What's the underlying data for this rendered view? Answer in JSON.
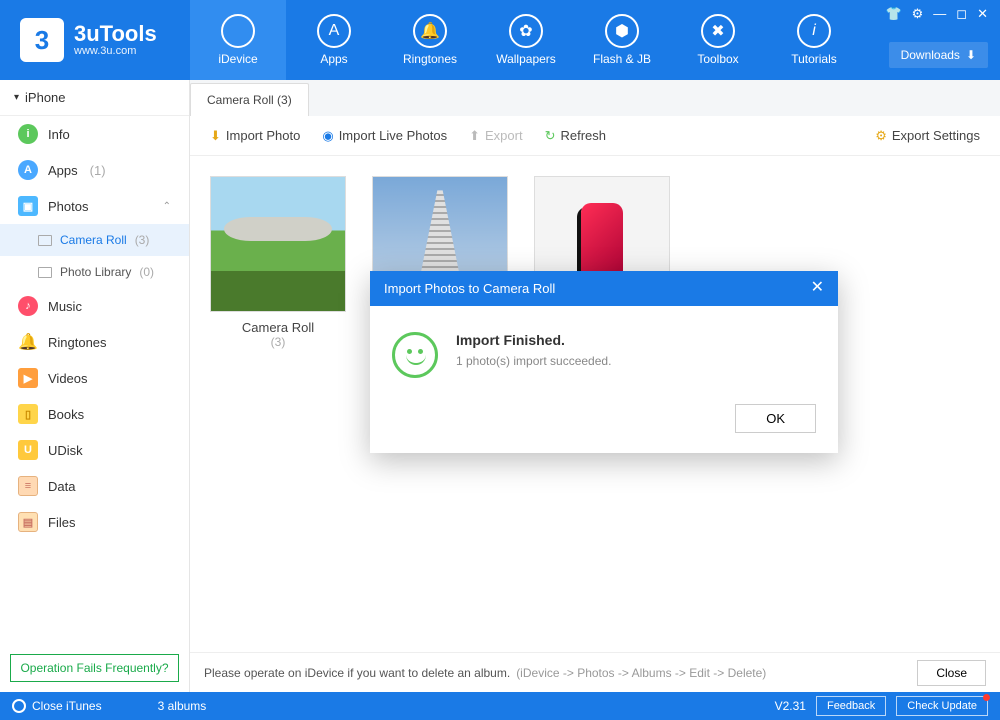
{
  "app": {
    "name": "3uTools",
    "url": "www.3u.com"
  },
  "nav": {
    "items": [
      {
        "label": "iDevice",
        "icon": "apple"
      },
      {
        "label": "Apps",
        "icon": "apps"
      },
      {
        "label": "Ringtones",
        "icon": "bell"
      },
      {
        "label": "Wallpapers",
        "icon": "wallpaper"
      },
      {
        "label": "Flash & JB",
        "icon": "box"
      },
      {
        "label": "Toolbox",
        "icon": "wrench"
      },
      {
        "label": "Tutorials",
        "icon": "info"
      }
    ],
    "active": 0,
    "downloads": "Downloads"
  },
  "sidebar": {
    "device": "iPhone",
    "items": {
      "info": "Info",
      "apps": "Apps",
      "apps_count": "(1)",
      "photos": "Photos",
      "camera_roll": "Camera Roll",
      "camera_roll_count": "(3)",
      "photo_library": "Photo Library",
      "photo_library_count": "(0)",
      "music": "Music",
      "ringtones": "Ringtones",
      "videos": "Videos",
      "books": "Books",
      "udisk": "UDisk",
      "data": "Data",
      "files": "Files"
    },
    "help_link": "Operation Fails Frequently?"
  },
  "tab": {
    "label": "Camera Roll (3)"
  },
  "toolbar": {
    "import_photo": "Import Photo",
    "import_live": "Import Live Photos",
    "export": "Export",
    "refresh": "Refresh",
    "export_settings": "Export Settings"
  },
  "albums": [
    {
      "name": "Camera Roll",
      "count": "(3)"
    }
  ],
  "modal": {
    "title": "Import Photos to Camera Roll",
    "heading": "Import Finished.",
    "message": "1 photo(s) import succeeded.",
    "ok": "OK"
  },
  "info_strip": {
    "text": "Please operate on iDevice if you want to delete an album.",
    "hint": "(iDevice -> Photos -> Albums -> Edit -> Delete)",
    "close": "Close"
  },
  "status": {
    "close_itunes": "Close iTunes",
    "albums_count": "3 albums",
    "version": "V2.31",
    "feedback": "Feedback",
    "check_update": "Check Update"
  }
}
